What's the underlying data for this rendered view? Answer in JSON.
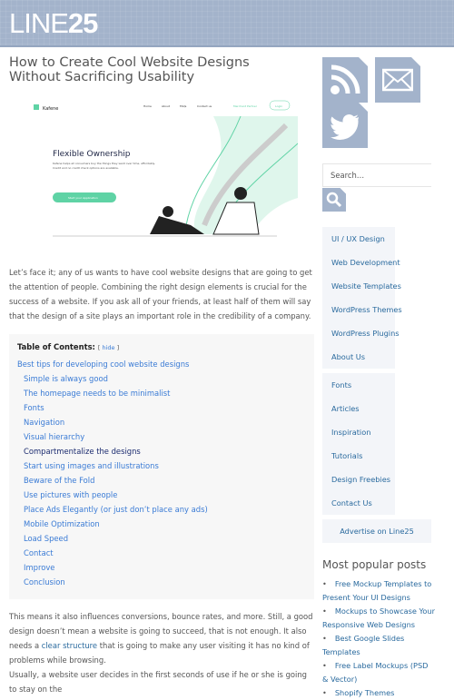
{
  "site": {
    "logo_light": "LINE",
    "logo_bold": "25"
  },
  "article": {
    "title": "How to Create Cool Website Designs Without Sacrificing Usability",
    "hero": {
      "brand": "Kafene",
      "nav": [
        "Home",
        "About",
        "FAQs",
        "Contact us"
      ],
      "merchant": "Merchant Partner",
      "login": "Login",
      "headline": "Flexible Ownership",
      "text": "Kafene helps all consumers buy the things they want over time, affordably. Credit and no credit check options are available.",
      "cta": "Start your Application",
      "accent": "#5fd3a5"
    },
    "p1": "Let’s face it; any of us wants to have cool website designs that are going to get the attention of people. Combining the right design elements is crucial for the success of a website. If you ask all of your friends, at least half of them will say that the design of a site plays an important role in the credibility of a company.",
    "p2_before": "This means it also influences conversions, bounce rates, and more. Still, a good design doesn’t mean a website is going to succeed, that is not enough. It also needs a ",
    "p2_link": "clear structure",
    "p2_after": " that is going to make any user visiting it has no kind of problems while browsing.",
    "p3": "Usually, a website user decides in the first seconds of use if he or she is going to stay on the"
  },
  "toc": {
    "title": "Table of Contents:",
    "hide": "hide",
    "items": [
      "Best tips for developing cool website designs",
      "Simple is always good",
      "The homepage needs to be minimalist",
      "Fonts",
      "Navigation",
      "Visual hierarchy",
      "Compartmentalize the designs",
      "Start using images and illustrations",
      "Beware of the Fold",
      "Use pictures with people",
      "Place Ads Elegantly (or just don’t place any ads)",
      "Mobile Optimization",
      "Load Speed",
      "Contact",
      "Improve",
      "Conclusion"
    ]
  },
  "sidebar": {
    "search_placeholder": "Search…",
    "categories1": [
      "UI / UX Design",
      "Web Development",
      "Website Templates",
      "WordPress Themes",
      "WordPress Plugins",
      "About Us"
    ],
    "categories2": [
      "Fonts",
      "Articles",
      "Inspiration",
      "Tutorials",
      "Design Freebies",
      "Contact Us"
    ],
    "advertise": "Advertise on Line25",
    "popular_title": "Most popular posts",
    "popular": [
      "Free Mockup Templates to Present Your UI Designs",
      "Mockups to Showcase Your Responsive Web Designs",
      "Best Google Slides Templates",
      "Free Label Mockups (PSD & Vector)",
      "Shopify Themes"
    ]
  },
  "colors": {
    "header": "#a3b3cb",
    "link": "#3a7bd5",
    "visited": "#1a2a6e"
  }
}
